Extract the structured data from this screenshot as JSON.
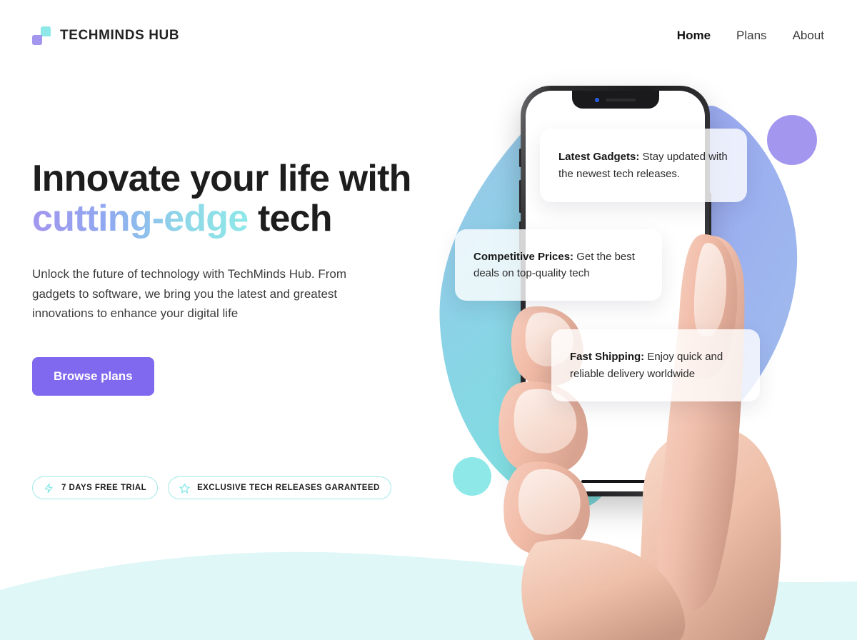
{
  "brand": {
    "name": "TECHMINDS HUB",
    "logo_icon": "two-squares-logo-icon",
    "colors": {
      "teal": "#8ee8e8",
      "purple": "#a396ee"
    }
  },
  "nav": {
    "items": [
      {
        "label": "Home",
        "active": true
      },
      {
        "label": "Plans",
        "active": false
      },
      {
        "label": "About",
        "active": false
      }
    ]
  },
  "hero": {
    "headline_line1": "Innovate your life with",
    "headline_accent": "cutting-edge",
    "headline_tail": " tech",
    "subcopy": "Unlock the future of technology with TechMinds Hub. From gadgets to software, we bring you the latest and greatest innovations to enhance your digital life",
    "cta_label": "Browse plans",
    "cta_color": "#8069ef",
    "accent_gradient_from": "#a396ee",
    "accent_gradient_to": "#8ee8e8"
  },
  "badges": [
    {
      "icon": "lightning-bolt-icon",
      "label": "7 DAYS FREE TRIAL"
    },
    {
      "icon": "star-icon",
      "label": "EXCLUSIVE TECH RELEASES GARANTEED"
    }
  ],
  "feature_cards": [
    {
      "id": "card-gadgets",
      "title": "Latest Gadgets:",
      "body": " Stay updated with the newest tech releases."
    },
    {
      "id": "card-prices",
      "title": "Competitive Prices:",
      "body": " Get the best deals on top-quality tech"
    },
    {
      "id": "card-shipping",
      "title": "Fast Shipping:",
      "body": " Enjoy quick and reliable delivery worldwide"
    }
  ],
  "decor": {
    "circle_purple": "#a396ee",
    "circle_teal": "#8ee8e8",
    "blob_blue_top": "#9ec4ea",
    "blob_teal_bottom": "#7fdfe0",
    "blob_periwinkle": "#9aa7f0",
    "wave_color": "#e0f7f7"
  }
}
